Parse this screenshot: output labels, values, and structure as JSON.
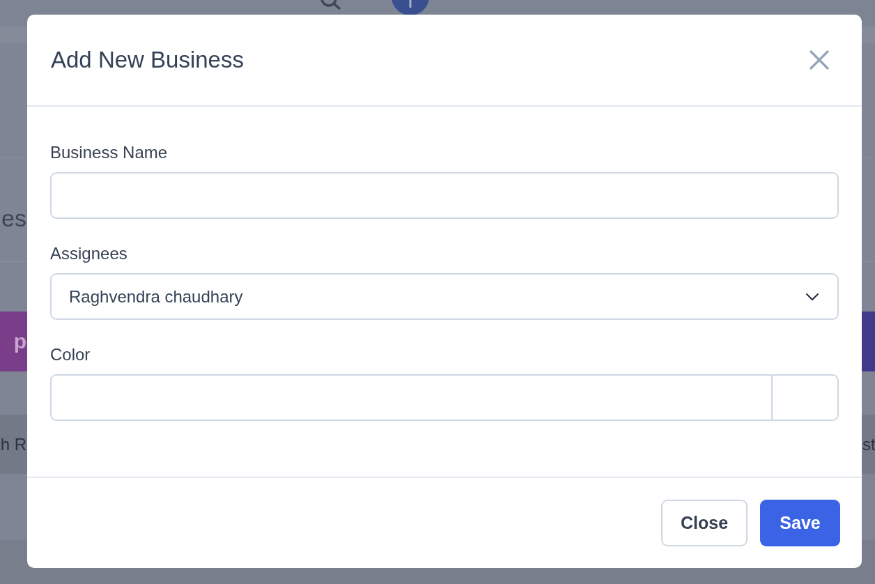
{
  "background": {
    "heading_fragment": "es",
    "banner_fragment": "p",
    "row_left_fragment": "h R",
    "row_right_fragment": "st"
  },
  "dialog": {
    "title": "Add New Business",
    "fields": [
      {
        "kind": "text",
        "label": "Business Name"
      },
      {
        "kind": "select",
        "label": "Assignees",
        "value": "Raghvendra chaudhary"
      },
      {
        "kind": "color",
        "label": "Color"
      }
    ],
    "buttons": [
      {
        "kind": "secondary",
        "label": "Close"
      },
      {
        "kind": "primary",
        "label": "Save"
      }
    ]
  }
}
